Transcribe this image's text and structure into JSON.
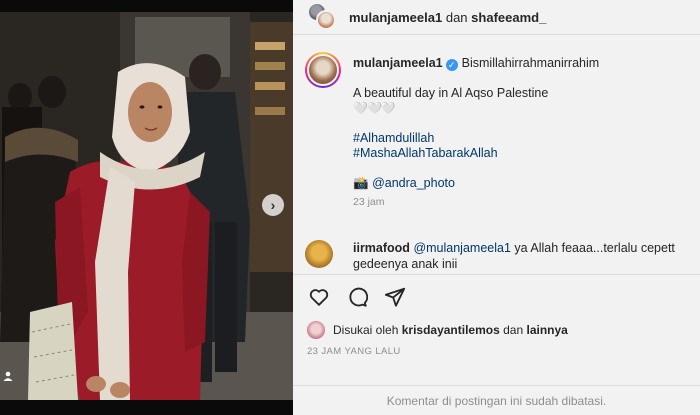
{
  "header": {
    "user1": "mulanjameela1",
    "separator": "dan",
    "user2": "shafeeamd_"
  },
  "caption": {
    "username": "mulanjameela1",
    "first_line": "Bismillahirrahmanirrahim",
    "line2": "A beautiful day in Al Aqso Palestine",
    "hearts": "🤍🤍🤍",
    "hashtag1": "#Alhamdulillah",
    "hashtag2": "#MashaAllahTabarakAllah",
    "camera_emoji": "📸",
    "photo_credit": "@andra_photo",
    "time": "23 jam"
  },
  "comment": {
    "username": "iirmafood",
    "mention": "@mulanjameela1",
    "text_rest": " ya Allah feaaa...terlalu cepett gedeenya anak inii"
  },
  "actions": {
    "icons": [
      "heart-icon",
      "comment-icon",
      "share-icon"
    ]
  },
  "likes": {
    "prefix": "Disukai oleh",
    "user": "krisdayantilemos",
    "connector": "dan",
    "others": "lainnya"
  },
  "post_time": "23 JAM YANG LALU",
  "footer_text": "Komentar di postingan ini sudah dibatasi.",
  "colors": {
    "panel_bg": "#f2f2f2",
    "link": "#00376b",
    "muted": "#8e8e8e",
    "verified": "#3897f0"
  }
}
